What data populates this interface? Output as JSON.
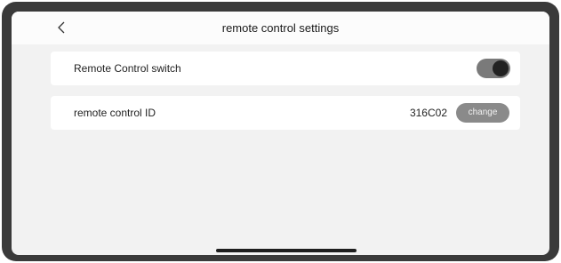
{
  "header": {
    "title": "remote control settings",
    "back_icon": "chevron-left-icon"
  },
  "settings": {
    "remote_switch": {
      "label": "Remote Control switch",
      "enabled": true
    },
    "remote_id": {
      "label": "remote control ID",
      "value": "316C02",
      "button_label": "change"
    }
  },
  "colors": {
    "screen_bg": "#f2f2f2",
    "card_bg": "#ffffff",
    "toggle_on": "#7a7a7a",
    "button_bg": "#8a8a8a"
  }
}
